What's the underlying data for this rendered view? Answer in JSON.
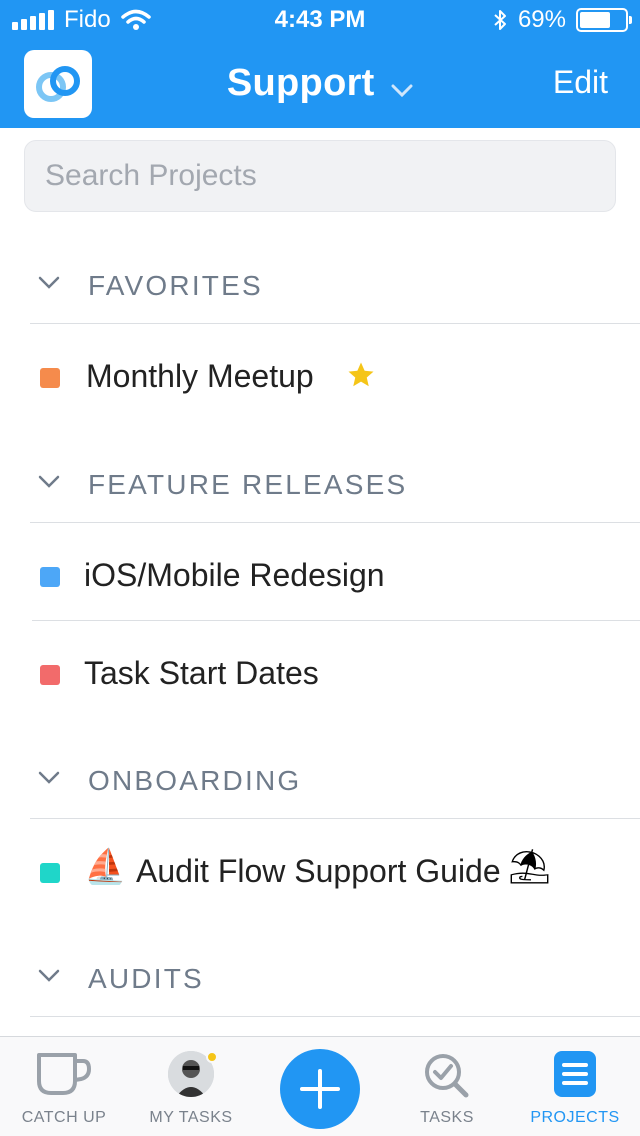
{
  "status_bar": {
    "carrier": "Fido",
    "time": "4:43 PM",
    "battery": "69%",
    "battery_level": 0.69
  },
  "header": {
    "title": "Support",
    "edit_label": "Edit"
  },
  "search": {
    "placeholder": "Search Projects"
  },
  "sections": [
    {
      "label": "FAVORITES"
    },
    {
      "label": "FEATURE RELEASES"
    },
    {
      "label": "ONBOARDING"
    },
    {
      "label": "AUDITS"
    }
  ],
  "projects": [
    {
      "name": "Monthly Meetup",
      "color": "#F58B4C",
      "starred": true
    },
    {
      "name": "iOS/Mobile Redesign",
      "color": "#4DA7F7"
    },
    {
      "name": "Task Start Dates",
      "color": "#F26B6B"
    },
    {
      "name": "Audit Flow Support Guide",
      "color": "#1FD6C9",
      "prefix_emoji": "⛵",
      "suffix_emoji": "⛱"
    }
  ],
  "tabs": [
    {
      "label": "CATCH UP",
      "icon": "cup-icon"
    },
    {
      "label": "MY TASKS",
      "icon": "avatar"
    },
    {
      "label": "",
      "icon": "plus-icon"
    },
    {
      "label": "TASKS",
      "icon": "search-check-icon"
    },
    {
      "label": "PROJECTS",
      "icon": "list-icon",
      "active": true
    }
  ],
  "colors": {
    "accent": "#2196F3",
    "section_text": "#6f7b8a",
    "star": "#F5C518"
  }
}
